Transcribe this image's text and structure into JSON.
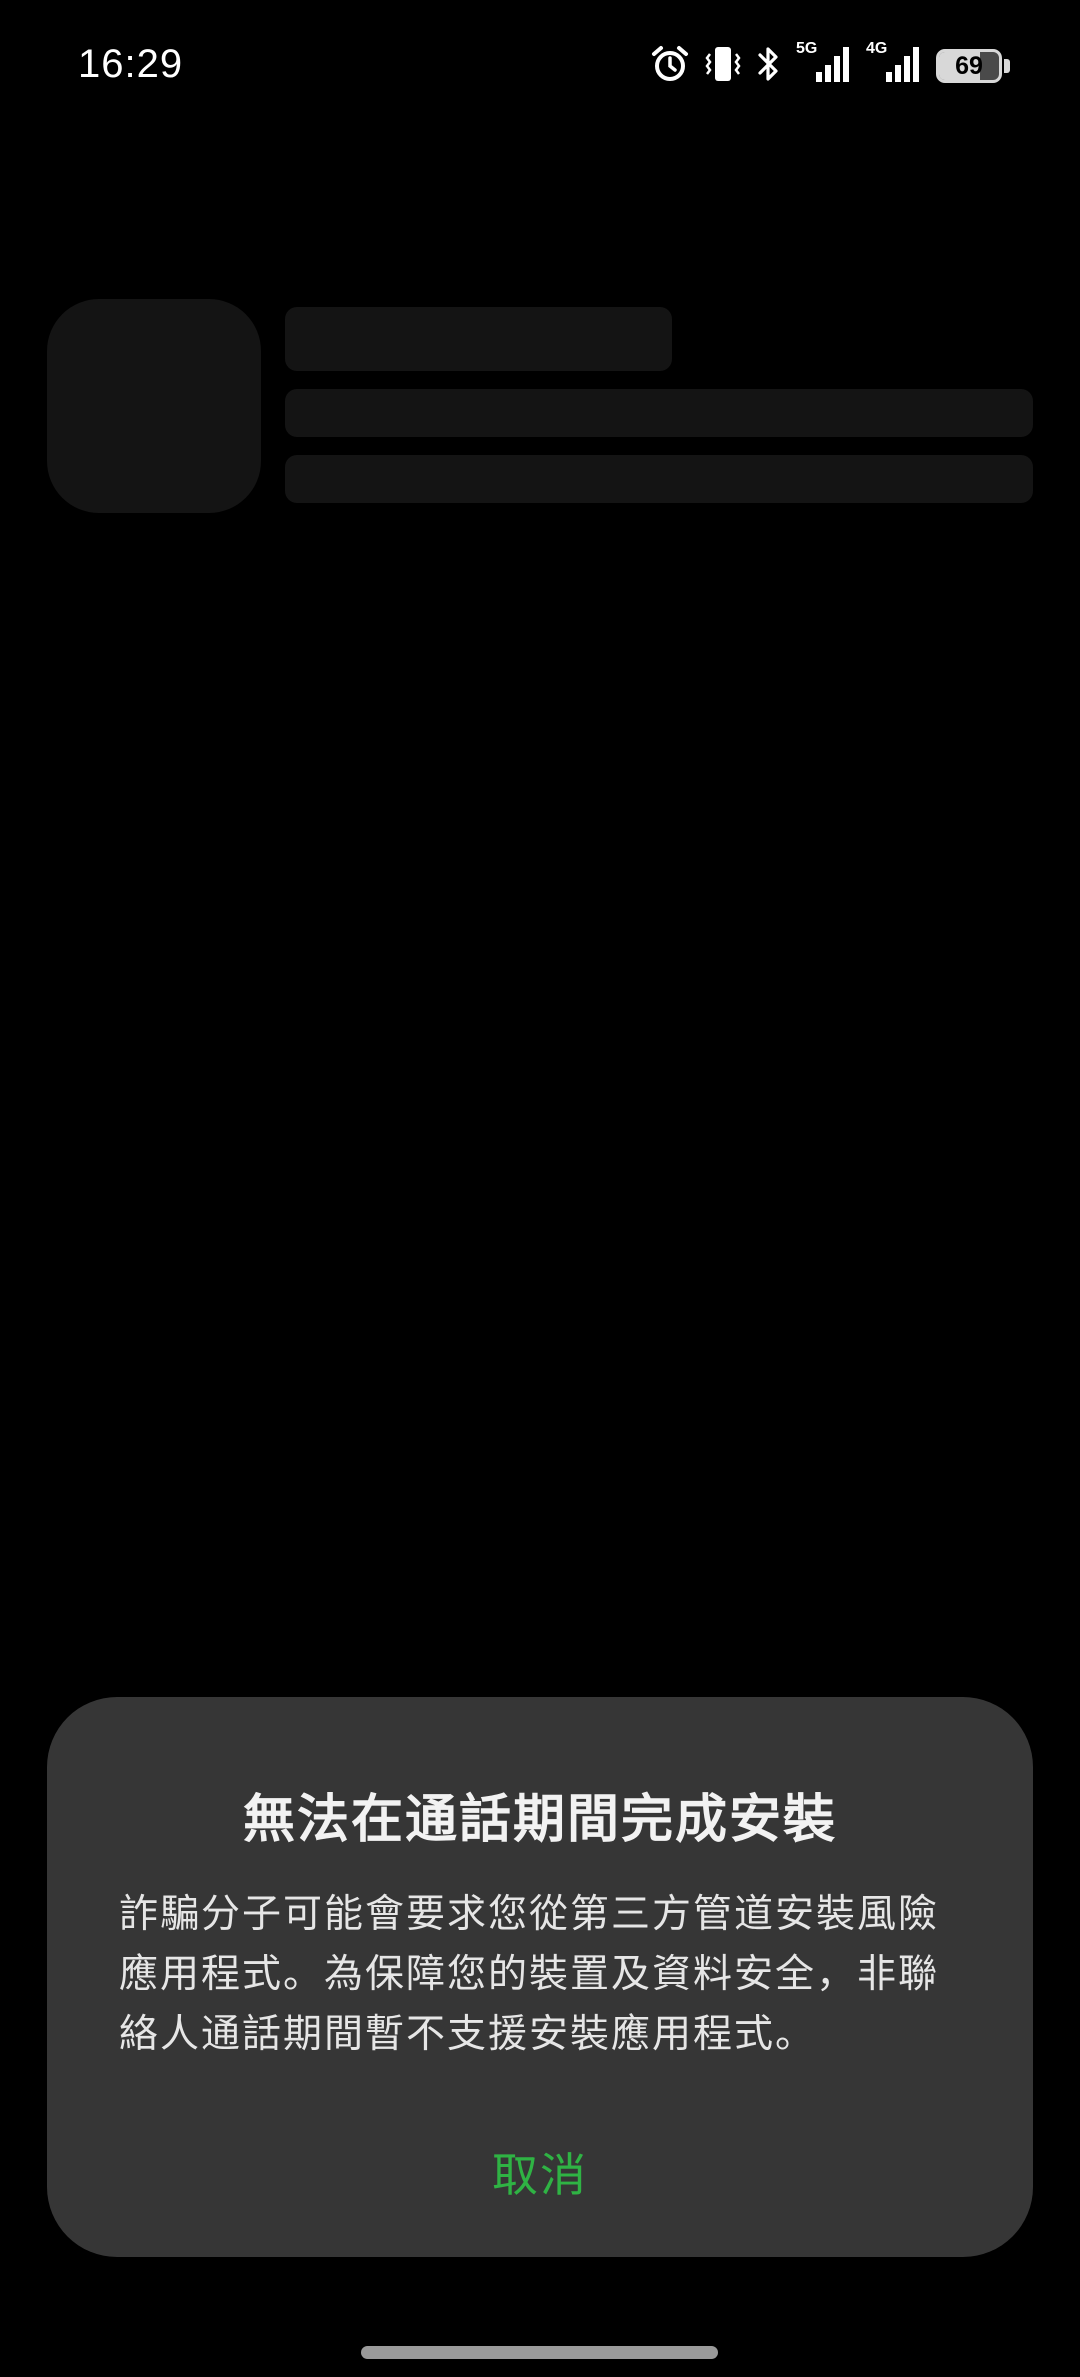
{
  "status_bar": {
    "time": "16:29",
    "icons": [
      "alarm-icon",
      "vibrate-icon",
      "bluetooth-icon",
      "signal-5g-icon",
      "signal-4g-icon",
      "battery-icon"
    ],
    "network_5g": "5G",
    "network_4g": "4G",
    "battery_level": "69",
    "battery_fraction": 0.69
  },
  "dialog": {
    "title": "無法在通話期間完成安裝",
    "message": "詐騙分子可能會要求您從第三方管道安裝風險應用程式。為保障您的裝置及資料安全，非聯絡人通話期間暫不支援安裝應用程式。",
    "cancel_label": "取消"
  },
  "colors": {
    "background": "#000000",
    "dialog_background": "#363636",
    "accent": "#2fb344",
    "skeleton": "#141414"
  }
}
